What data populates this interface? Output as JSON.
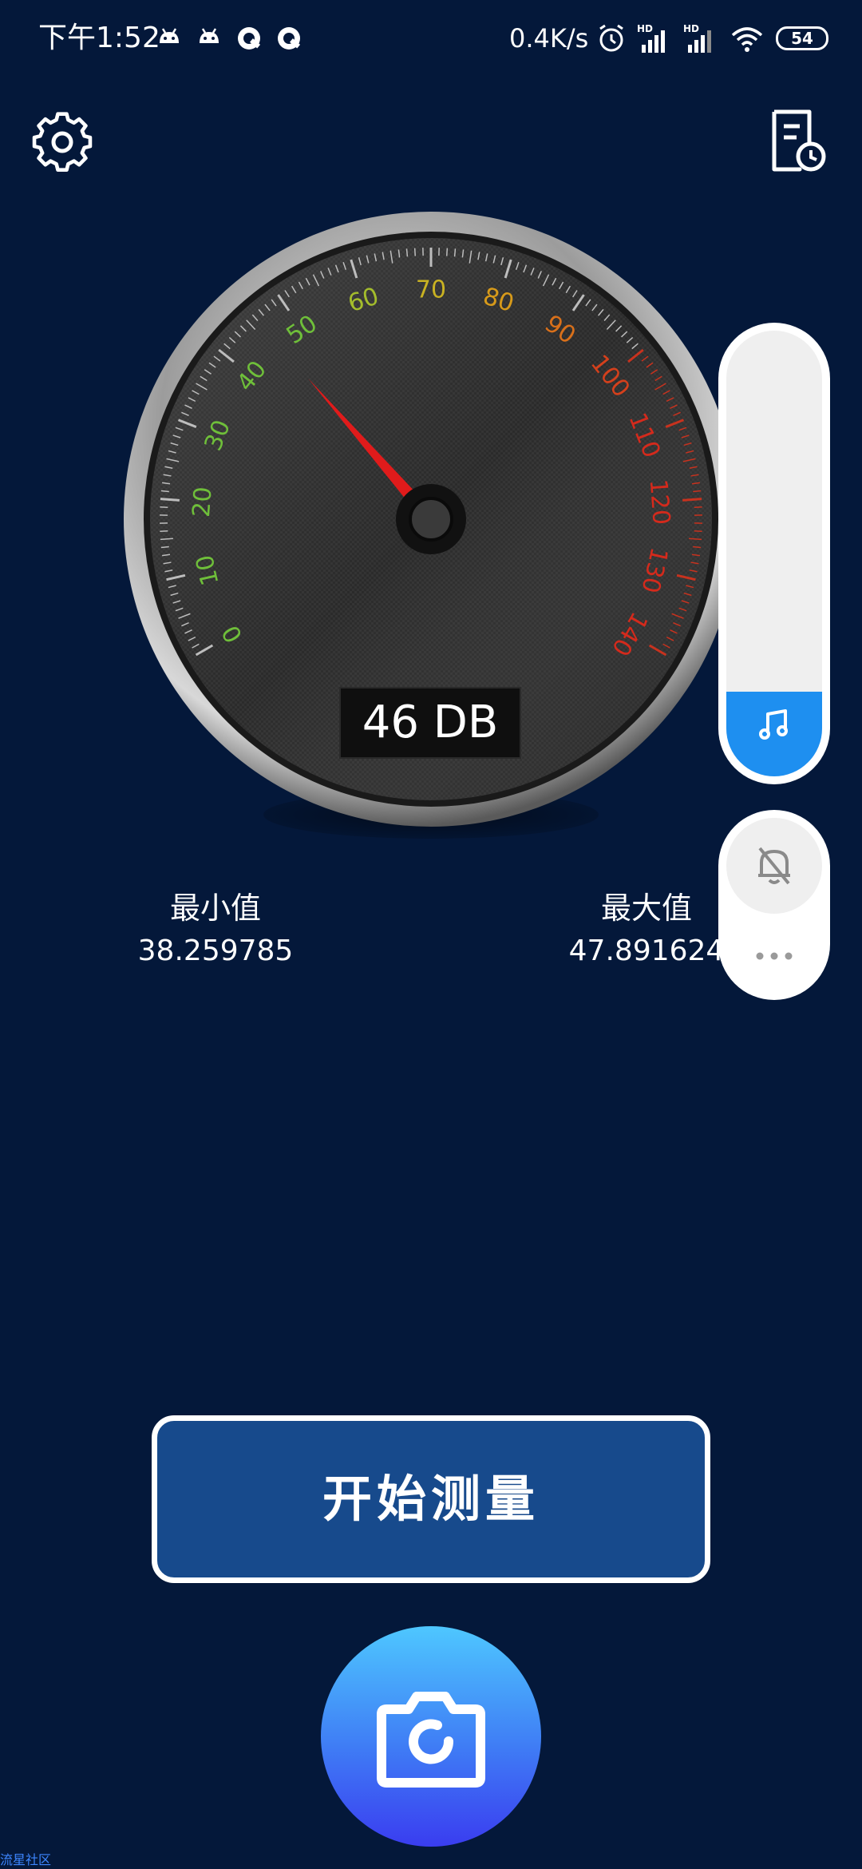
{
  "status_bar": {
    "time": "下午1:52",
    "network_speed": "0.4K/s",
    "battery": "54",
    "signal_1_label": "HD",
    "signal_2_label": "HD"
  },
  "gauge": {
    "reading": "46 DB",
    "value": 46,
    "scale_min": 0,
    "scale_max": 140,
    "tick_labels": [
      "0",
      "10",
      "20",
      "30",
      "40",
      "50",
      "60",
      "70",
      "80",
      "90",
      "100",
      "110",
      "120",
      "130",
      "140"
    ],
    "label_colors": [
      "#6fbf3a",
      "#6fbf3a",
      "#6fbf3a",
      "#6fbf3a",
      "#6fbf3a",
      "#6fbf3a",
      "#a4bd2c",
      "#c9b222",
      "#d79a1a",
      "#d9701a",
      "#d4401c",
      "#d42a1c",
      "#d42a1c",
      "#d42a1c",
      "#d42a1c"
    ]
  },
  "stats": {
    "min_label": "最小值",
    "min_value": "38.259785",
    "max_label": "最大值",
    "max_value": "47.891624"
  },
  "volume_overlay": {
    "level": 0.19,
    "accent": "#1e8ff0"
  },
  "start_button": {
    "label": "开始测量"
  },
  "watermark": "流星社区",
  "colors": {
    "background": "#04183a",
    "button": "#174a8c",
    "needle": "#e01b1b"
  }
}
